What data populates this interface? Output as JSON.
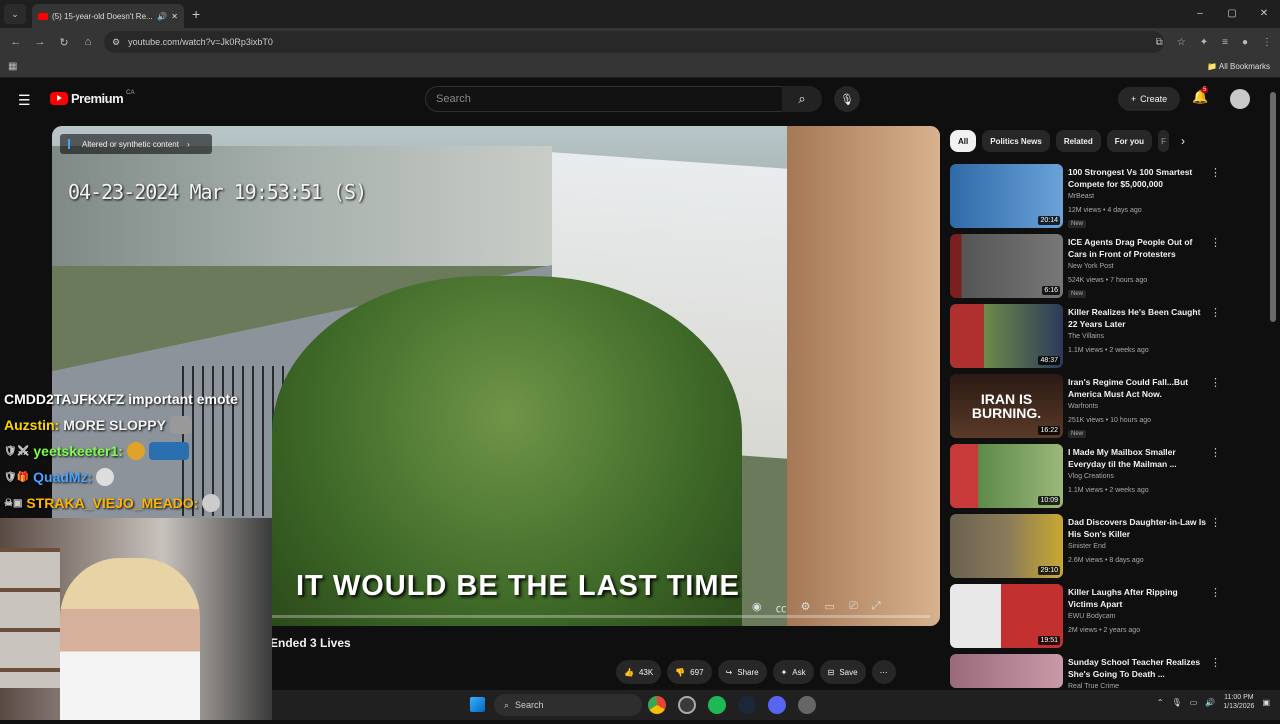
{
  "browser": {
    "tab_title": "(5) 15-year-old Doesn't Re...",
    "new_tab": "+",
    "url": "youtube.com/watch?v=Jk0Rp3ixbT0",
    "all_bookmarks": "All Bookmarks",
    "window_controls": [
      "–",
      "▢",
      "✕"
    ]
  },
  "header": {
    "logo_text": "Premium",
    "country_code": "CA",
    "search_placeholder": "Search",
    "create_label": "Create",
    "notification_count": "5"
  },
  "video": {
    "ai_label": "Altered or synthetic content",
    "timestamp": "04-23-2024 Mar  19:53:51 (S)",
    "caption": "IT WOULD BE THE LAST TIME",
    "title_fragment": "Ended 3 Lives",
    "likes": "43K",
    "dislikes": "697",
    "share": "Share",
    "ask": "Ask",
    "save": "Save"
  },
  "chat": [
    {
      "user": "CMDD2TAJFKXFZ",
      "msg": "important emote",
      "color": "#ffffff"
    },
    {
      "user": "Auzstin:",
      "msg": "MORE SLOPPY",
      "color": "#ffd700"
    },
    {
      "user": "yeetskeeter1:",
      "msg": "",
      "color": "#7dff4a"
    },
    {
      "user": "QuadMz:",
      "msg": "",
      "color": "#4aa3ff"
    },
    {
      "user": "STRAKA_VIEJO_MEADO:",
      "msg": "",
      "color": "#ffb400"
    }
  ],
  "chips": [
    "All",
    "Politics News",
    "Related",
    "For you",
    "F"
  ],
  "recommendations": [
    {
      "title": "100 Strongest Vs 100 Smartest Compete for $5,000,000",
      "channel": "MrBeast",
      "meta": "12M views • 4 days ago",
      "badge": "New",
      "duration": "20:14",
      "color": "#3a6fb0"
    },
    {
      "title": "ICE Agents Drag People Out of Cars in Front of Protesters",
      "channel": "New York Post",
      "meta": "524K views • 7 hours ago",
      "badge": "New",
      "duration": "6:16",
      "color": "#5a5555"
    },
    {
      "title": "Killer Realizes He's Been Caught 22 Years Later",
      "channel": "The Villains",
      "meta": "1.1M views • 2 weeks ago",
      "badge": "",
      "duration": "48:37",
      "color": "#7a8c5a"
    },
    {
      "title": "Iran's Regime Could Fall...But America Must Act Now.",
      "channel": "Warfronts",
      "meta": "251K views • 10 hours ago",
      "badge": "New",
      "duration": "16:22",
      "color": "#3a2a22"
    },
    {
      "title": "I Made My Mailbox Smaller Everyday til the Mailman ...",
      "channel": "Vlog Creations",
      "meta": "1.1M views • 2 weeks ago",
      "badge": "",
      "duration": "10:09",
      "color": "#5d8a4a"
    },
    {
      "title": "Dad Discovers Daughter-in-Law Is His Son's Killer",
      "channel": "Sinister End",
      "meta": "2.6M views • 8 days ago",
      "badge": "",
      "duration": "29:10",
      "color": "#6a6250"
    },
    {
      "title": "Killer Laughs After Ripping Victims Apart",
      "channel": "EWU Bodycam",
      "meta": "2M views • 2 years ago",
      "badge": "",
      "duration": "19:51",
      "color": "#c23030"
    },
    {
      "title": "Sunday School Teacher Realizes She's Going To Death ...",
      "channel": "Real True Crime",
      "meta": "",
      "badge": "",
      "duration": "",
      "color": "#9a6a7a"
    }
  ],
  "thumb_overlays": {
    "iran": "IRAN IS BURNING."
  },
  "taskbar": {
    "search": "Search",
    "time": "11:00 PM",
    "date": "1/13/2026"
  },
  "colors": {
    "accent": "#ff0000",
    "background": "#0f0f0f"
  }
}
